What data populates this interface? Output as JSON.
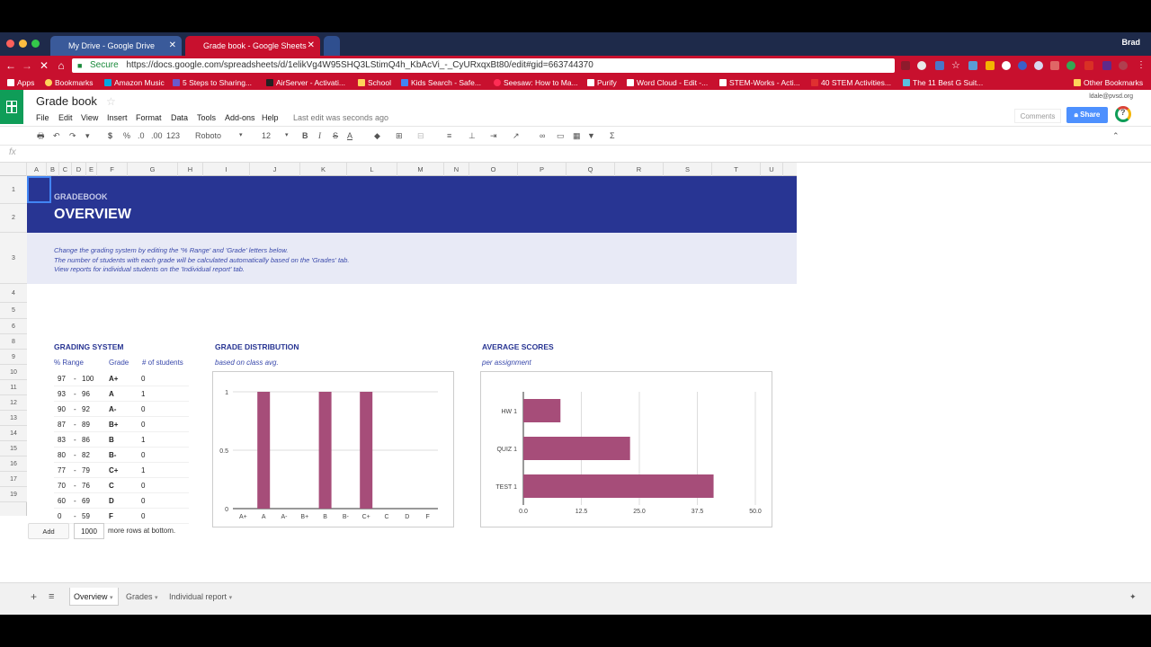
{
  "browser": {
    "tabs": [
      {
        "title": "My Drive - Google Drive",
        "active": false
      },
      {
        "title": "Grade book - Google Sheets",
        "active": true
      }
    ],
    "user": "Brad",
    "url_secure_label": "Secure",
    "url": "https://docs.google.com/spreadsheets/d/1elikVg4W95SHQ3LStimQ4h_KbAcVi_-_CyURxqxBt80/edit#gid=663744370",
    "bookmarks": [
      "Apps",
      "Bookmarks",
      "Amazon Music",
      "5 Steps to Sharing...",
      "AirServer - Activati...",
      "School",
      "Kids Search - Safe...",
      "Seesaw: How to Ma...",
      "Purify",
      "Word Cloud - Edit -...",
      "STEM-Works - Acti...",
      "40 STEM Activities...",
      "The 11 Best G Suit...",
      "Other Bookmarks"
    ],
    "colors": {
      "tabstrip": "#1e2a4a",
      "toolbar": "#c8102e"
    }
  },
  "doc": {
    "title": "Grade book",
    "menus": [
      "File",
      "Edit",
      "View",
      "Insert",
      "Format",
      "Data",
      "Tools",
      "Add-ons",
      "Help"
    ],
    "last_edit": "Last edit was seconds ago",
    "account": "ldale@pvsd.org",
    "comments_label": "Comments",
    "share_label": "Share"
  },
  "toolbar": {
    "currency": "$",
    "percent": "%",
    "dec_less": ".0",
    "dec_more": ".00",
    "format_more": "123",
    "font": "Roboto",
    "font_size": "12",
    "bold": "B",
    "italic": "I",
    "strike": "S",
    "text_color": "A",
    "fx": "fx"
  },
  "grid": {
    "columns": [
      "A",
      "B",
      "C",
      "D",
      "E",
      "F",
      "G",
      "H",
      "I",
      "J",
      "K",
      "L",
      "M",
      "N",
      "O",
      "P",
      "Q",
      "R",
      "S",
      "T",
      "U"
    ],
    "rows": [
      "1",
      "2",
      "3",
      "4",
      "5",
      "6",
      "8",
      "9",
      "10",
      "11",
      "12",
      "13",
      "14",
      "15",
      "16",
      "17",
      "19"
    ]
  },
  "sheet": {
    "banner_kicker": "GRADEBOOK",
    "banner_title": "OVERVIEW",
    "info": [
      "Change the grading system by editing the '% Range' and 'Grade' letters below.",
      "The number of students with each grade will be calculated automatically based on the 'Grades' tab.",
      "View reports for individual students on the 'Individual report' tab."
    ],
    "grading": {
      "title": "GRADING SYSTEM",
      "headers": [
        "% Range",
        "Grade",
        "# of students"
      ],
      "rows": [
        {
          "lo": "97",
          "hi": "100",
          "grade": "A+",
          "count": "0"
        },
        {
          "lo": "93",
          "hi": "96",
          "grade": "A",
          "count": "1"
        },
        {
          "lo": "90",
          "hi": "92",
          "grade": "A-",
          "count": "0"
        },
        {
          "lo": "87",
          "hi": "89",
          "grade": "B+",
          "count": "0"
        },
        {
          "lo": "83",
          "hi": "86",
          "grade": "B",
          "count": "1"
        },
        {
          "lo": "80",
          "hi": "82",
          "grade": "B-",
          "count": "0"
        },
        {
          "lo": "77",
          "hi": "79",
          "grade": "C+",
          "count": "1"
        },
        {
          "lo": "70",
          "hi": "76",
          "grade": "C",
          "count": "0"
        },
        {
          "lo": "60",
          "hi": "69",
          "grade": "D",
          "count": "0"
        },
        {
          "lo": "0",
          "hi": "59",
          "grade": "F",
          "count": "0"
        }
      ]
    },
    "distribution": {
      "title": "GRADE DISTRIBUTION",
      "subtitle": "based on class avg."
    },
    "averages": {
      "title": "AVERAGE SCORES",
      "subtitle": "per assignment"
    }
  },
  "chart_data": [
    {
      "type": "bar",
      "categories": [
        "A+",
        "A",
        "A-",
        "B+",
        "B",
        "B-",
        "C+",
        "C",
        "D",
        "F"
      ],
      "values": [
        0,
        1,
        0,
        0,
        1,
        0,
        1,
        0,
        0,
        0
      ],
      "ylim": [
        0,
        1
      ],
      "yticks": [
        "0",
        "0.5",
        "1"
      ],
      "color": "#a64d79"
    },
    {
      "type": "bar",
      "orientation": "horizontal",
      "categories": [
        "HW 1",
        "QUIZ 1",
        "TEST 1"
      ],
      "values": [
        8,
        23,
        41
      ],
      "xlim": [
        0,
        50
      ],
      "xticks": [
        "0.0",
        "12.5",
        "25.0",
        "37.5",
        "50.0"
      ],
      "color": "#a64d79"
    }
  ],
  "bottom": {
    "add_label": "Add",
    "rows_value": "1000",
    "rows_suffix": "more rows at bottom.",
    "sheet_tabs": [
      "Overview",
      "Grades",
      "Individual report"
    ]
  }
}
